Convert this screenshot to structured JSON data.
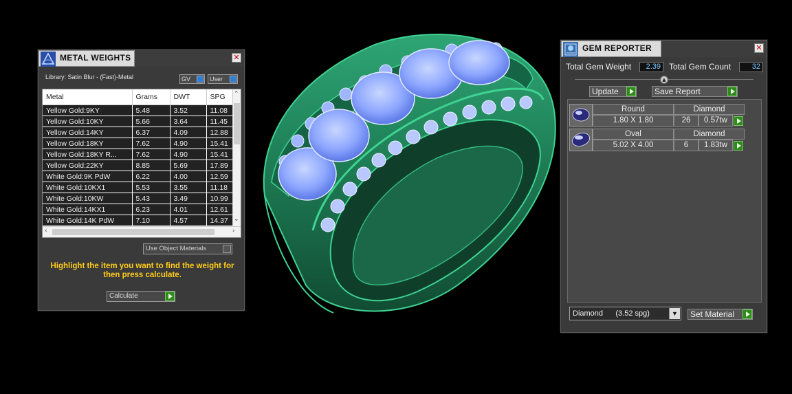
{
  "metal_weights": {
    "title": "METAL WEIGHTS",
    "library": "Library: Satin Blur - (Fast)-Metal",
    "toggles": [
      "GV",
      "User"
    ],
    "columns": [
      "Metal",
      "Grams",
      "DWT",
      "SPG"
    ],
    "rows": [
      [
        "Yellow Gold:9KY",
        "5.48",
        "3.52",
        "11.08"
      ],
      [
        "Yellow Gold:10KY",
        "5.66",
        "3.64",
        "11.45"
      ],
      [
        "Yellow Gold:14KY",
        "6.37",
        "4.09",
        "12.88"
      ],
      [
        "Yellow Gold:18KY",
        "7.62",
        "4.90",
        "15.41"
      ],
      [
        "Yellow Gold:18KY R...",
        "7.62",
        "4.90",
        "15.41"
      ],
      [
        "Yellow Gold:22KY",
        "8.85",
        "5.69",
        "17.89"
      ],
      [
        "White Gold:9K PdW",
        "6.22",
        "4.00",
        "12.59"
      ],
      [
        "White Gold:10KX1",
        "5.53",
        "3.55",
        "11.18"
      ],
      [
        "White Gold:10KW",
        "5.43",
        "3.49",
        "10.99"
      ],
      [
        "White Gold:14KX1",
        "6.23",
        "4.01",
        "12.61"
      ],
      [
        "White Gold:14K PdW",
        "7.10",
        "4.57",
        "14.37"
      ]
    ],
    "use_object_materials": "Use Object Materials",
    "hint": "Highlight the item you want to find the weight for then press calculate.",
    "calculate": "Calculate"
  },
  "gem_reporter": {
    "title": "GEM REPORTER",
    "total_weight_label": "Total Gem Weight",
    "total_weight_value": "2.39",
    "total_count_label": "Total Gem Count",
    "total_count_value": "32",
    "update": "Update",
    "save_report": "Save Report",
    "gems": [
      {
        "shape": "Round",
        "material": "Diamond",
        "size": "1.80 X 1.80",
        "count": "26",
        "weight": "0.57tw"
      },
      {
        "shape": "Oval",
        "material": "Diamond",
        "size": "5.02 X 4.00",
        "count": "6",
        "weight": "1.83tw"
      }
    ],
    "material_select": "Diamond      (3.52 spg)",
    "set_material": "Set Material"
  },
  "colors": {
    "ring_metal": "#1f7a55",
    "ring_edge": "#3fd392",
    "gem": "#8fa8ff",
    "hint_text": "#ffcc1a",
    "value_text": "#7fc6ff"
  }
}
